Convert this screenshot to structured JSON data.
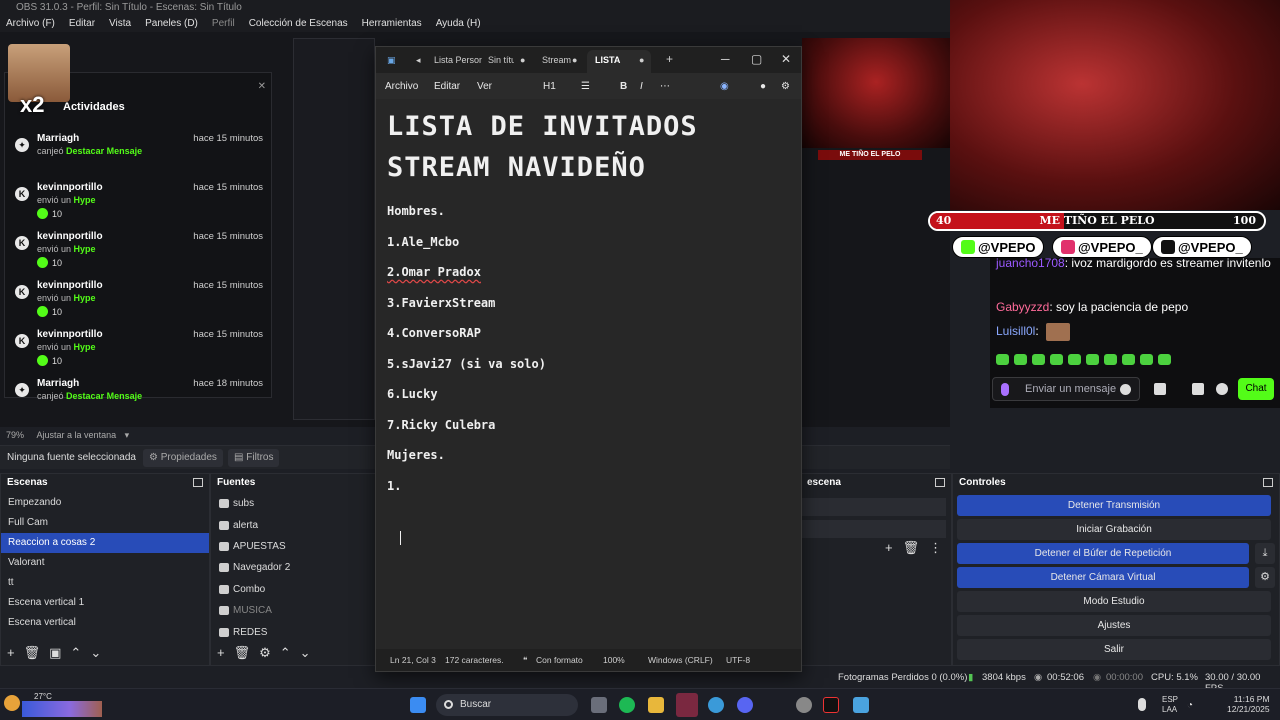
{
  "obs": {
    "title": "OBS 31.0.3 - Perfil: Sin Título - Escenas: Sin Título",
    "menu": [
      "Archivo (F)",
      "Editar",
      "Vista",
      "Paneles (D)",
      "Perfil",
      "Colección de Escenas",
      "Herramientas",
      "Ayuda (H)"
    ],
    "zoom": "79%",
    "zoom_mode": "Ajustar a la ventana",
    "no_source": "Ninguna fuente seleccionada",
    "properties_tab": "Propiedades",
    "filters_tab": "Filtros"
  },
  "activity": {
    "title": "Actividades",
    "badge": "x2",
    "items": [
      {
        "name": "Marriagh",
        "time": "hace 15 minutos",
        "action": "canjeó",
        "highlight": "Destacar Mensaje",
        "points": "",
        "icon": "gear-icon"
      },
      {
        "name": "kevinnportillo",
        "time": "hace 15 minutos",
        "action": "envió un",
        "highlight": "Hype",
        "points": "10",
        "icon": "kick-icon"
      },
      {
        "name": "kevinnportillo",
        "time": "hace 15 minutos",
        "action": "envió un",
        "highlight": "Hype",
        "points": "10",
        "icon": "kick-icon"
      },
      {
        "name": "kevinnportillo",
        "time": "hace 15 minutos",
        "action": "envió un",
        "highlight": "Hype",
        "points": "10",
        "icon": "kick-icon"
      },
      {
        "name": "kevinnportillo",
        "time": "hace 15 minutos",
        "action": "envió un",
        "highlight": "Hype",
        "points": "10",
        "icon": "kick-icon"
      },
      {
        "name": "Marriagh",
        "time": "hace 18 minutos",
        "action": "canjeó",
        "highlight": "Destacar Mensaje",
        "points": "",
        "icon": "gear-icon"
      }
    ]
  },
  "overlay": {
    "mini_banner": "ME TIÑO EL PELO",
    "bar_left": "40",
    "bar_title": "ME TIÑO EL PELO",
    "bar_right": "100",
    "bar_fill_fraction": 0.4,
    "socials": [
      {
        "icon": "kick-icon",
        "handle": "@VPEPO",
        "color": "#53fc18"
      },
      {
        "icon": "instagram-icon",
        "handle": "@VPEPO_",
        "color": "#e1306c"
      },
      {
        "icon": "tiktok-icon",
        "handle": "@VPEPO_",
        "color": "#111111"
      }
    ]
  },
  "chat": {
    "lines": [
      {
        "user": "juancho1708",
        "text": ": ivoz mardigordo es streamer invitenlo"
      },
      {
        "user": "Gabyyzzd",
        "text": ": soy la paciencia de pepo"
      },
      {
        "user": "Luisill0l",
        "text": ":"
      }
    ],
    "placeholder": "Enviar un mensaje",
    "send_label": "Chat"
  },
  "notepad": {
    "tabs": [
      "Lista Personal",
      "Sin título",
      "Stream",
      "LISTA DE"
    ],
    "menu": [
      "Archivo",
      "Editar",
      "Ver"
    ],
    "heading_style": "H1",
    "title_lines": [
      "LISTA DE INVITADOS",
      "STREAM NAVIDEÑO"
    ],
    "lines": [
      "Hombres.",
      "1.Ale_Mcbo",
      "2.Omar Pradox",
      "3.FavierxStream",
      "4.ConversoRAP",
      "5.sJavi27 (si va solo)",
      "6.Lucky",
      "7.Ricky Culebra",
      "Mujeres.",
      "1."
    ],
    "status": {
      "position": "Ln 21, Col 3",
      "chars": "172 caracteres.",
      "format": "Con formato",
      "zoom": "100%",
      "eol": "Windows (CRLF)",
      "encoding": "UTF-8"
    }
  },
  "scenes": {
    "title": "Escenas",
    "items": [
      "Empezando",
      "Full Cam",
      "Reaccion a cosas 2",
      "Valorant",
      "tt",
      "Escena vertical 1",
      "Escena vertical"
    ],
    "selected_index": 2
  },
  "sources": {
    "title": "Fuentes",
    "items": [
      "subs",
      "alerta",
      "APUESTAS",
      "Navegador 2",
      "Combo",
      "MUSICA",
      "REDES"
    ]
  },
  "mixer": {
    "title": "escena"
  },
  "controls": {
    "title": "Controles",
    "buttons": [
      {
        "label": "Detener Transmisión",
        "active": true
      },
      {
        "label": "Iniciar Grabación",
        "active": false
      },
      {
        "label": "Detener el Búfer de Repetición",
        "active": true
      },
      {
        "label": "Detener Cámara Virtual",
        "active": true
      },
      {
        "label": "Modo Estudio",
        "active": false
      },
      {
        "label": "Ajustes",
        "active": false
      },
      {
        "label": "Salir",
        "active": false
      }
    ]
  },
  "status": {
    "dropped": "Fotogramas Perdidos 0 (0.0%)",
    "bitrate": "3804 kbps",
    "live_time": "00:52:06",
    "rec_time": "00:00:00",
    "cpu": "CPU: 5.1%",
    "fps": "30.00 / 30.00 FPS"
  },
  "taskbar": {
    "weather": "27°C",
    "search": "Buscar",
    "lang": "ESP",
    "lang2": "LAA",
    "time": "11:16 PM",
    "date": "12/21/2025"
  }
}
